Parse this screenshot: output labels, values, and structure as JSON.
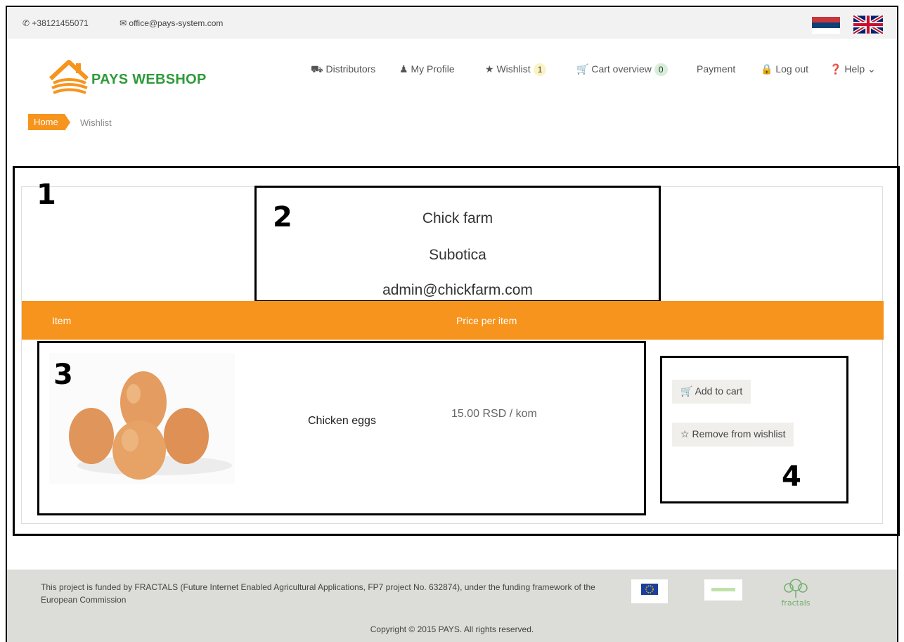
{
  "topbar": {
    "phone": "+38121455071",
    "email": "office@pays-system.com"
  },
  "brand": {
    "name": "PAYS WEBSHOP",
    "color": "#2f9a3a",
    "accent": "#f7941d"
  },
  "nav": {
    "distributors": "Distributors",
    "profile": "My Profile",
    "wishlist": "Wishlist",
    "wishlist_count": "1",
    "cart": "Cart overview",
    "cart_count": "0",
    "payment": "Payment",
    "logout": "Log out",
    "help": "Help"
  },
  "breadcrumb": {
    "home": "Home",
    "current": "Wishlist"
  },
  "annotations": {
    "n1": "1",
    "n2": "2",
    "n3": "3",
    "n4": "4"
  },
  "vendor": {
    "name": "Chick farm",
    "city": "Subotica",
    "email": "admin@chickfarm.com"
  },
  "table": {
    "col_item": "Item",
    "col_price": "Price per item"
  },
  "item": {
    "name": "Chicken eggs",
    "price": "15.00 RSD / kom",
    "add_to_cart": "Add to cart",
    "remove": "Remove from wishlist"
  },
  "footer": {
    "funding": "This project is funded by FRACTALS (Future Internet Enabled Agricultural Applications, FP7 project No. 632874), under the funding framework of the European Commission",
    "fractals_logo_text": "fractals",
    "copyright": "Copyright © 2015 PAYS. All rights reserved."
  }
}
